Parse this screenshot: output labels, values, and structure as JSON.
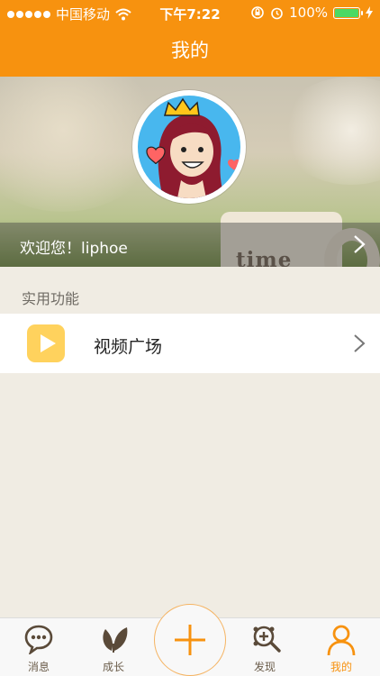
{
  "status_bar": {
    "carrier": "中国移动",
    "time": "下午7:22",
    "battery": "100%",
    "icons": [
      "signal-dots-icon",
      "wifi-icon",
      "orientation-lock-icon",
      "alarm-icon",
      "battery-icon",
      "charging-icon"
    ]
  },
  "navbar": {
    "title": "我的"
  },
  "banner": {
    "mug_text": "time",
    "welcome_prefix": "欢迎您！",
    "username": "liphoe",
    "icons": [
      "avatar",
      "chevron-right-icon"
    ]
  },
  "section": {
    "title": "实用功能"
  },
  "list": {
    "items": [
      {
        "label": "视频广场",
        "icon": "play-icon"
      }
    ]
  },
  "tabbar": {
    "tabs": [
      {
        "label": "消息",
        "icon": "chat-bubble-icon"
      },
      {
        "label": "成长",
        "icon": "leaf-icon"
      },
      {
        "label": "",
        "icon": "plus-icon"
      },
      {
        "label": "发现",
        "icon": "discover-icon"
      },
      {
        "label": "我的",
        "icon": "person-icon",
        "active": true
      }
    ]
  },
  "colors": {
    "accent": "#f7920f",
    "background": "#f0ece3",
    "play_icon": "#ffd25d",
    "battery_fill": "#4cd964"
  }
}
